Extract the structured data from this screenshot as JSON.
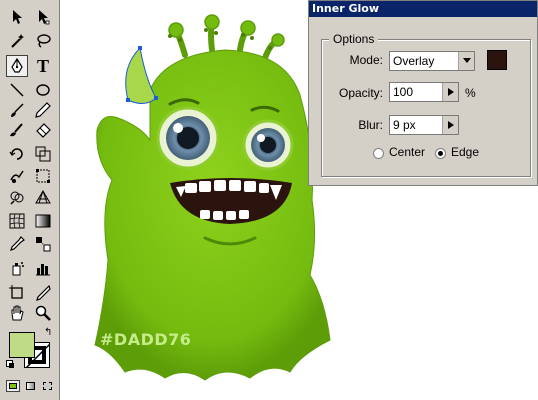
{
  "toolbox": {
    "tools": [
      {
        "name": "selection-tool",
        "icon": "arrow-icon"
      },
      {
        "name": "direct-selection-tool",
        "icon": "white-arrow-icon"
      },
      {
        "name": "magic-wand-tool",
        "icon": "wand-icon"
      },
      {
        "name": "lasso-tool",
        "icon": "lasso-icon"
      },
      {
        "name": "pen-tool",
        "icon": "pen-icon",
        "active": true
      },
      {
        "name": "type-tool",
        "icon": "type-icon",
        "glyph": "T"
      },
      {
        "name": "line-tool",
        "icon": "line-icon"
      },
      {
        "name": "ellipse-tool",
        "icon": "ellipse-icon"
      },
      {
        "name": "paintbrush-tool",
        "icon": "brush-icon"
      },
      {
        "name": "pencil-tool",
        "icon": "pencil-icon"
      },
      {
        "name": "blob-brush-tool",
        "icon": "blob-brush-icon"
      },
      {
        "name": "eraser-tool",
        "icon": "eraser-icon"
      },
      {
        "name": "rotate-tool",
        "icon": "rotate-icon"
      },
      {
        "name": "scale-tool",
        "icon": "scale-icon"
      },
      {
        "name": "warp-tool",
        "icon": "warp-icon"
      },
      {
        "name": "free-transform-tool",
        "icon": "free-transform-icon"
      },
      {
        "name": "shape-builder-tool",
        "icon": "shape-builder-icon"
      },
      {
        "name": "perspective-grid-tool",
        "icon": "perspective-icon"
      },
      {
        "name": "mesh-tool",
        "icon": "mesh-icon"
      },
      {
        "name": "gradient-tool",
        "icon": "gradient-icon"
      },
      {
        "name": "eyedropper-tool",
        "icon": "eyedropper-icon"
      },
      {
        "name": "blend-tool",
        "icon": "blend-icon"
      },
      {
        "name": "symbol-sprayer-tool",
        "icon": "symbol-sprayer-icon"
      },
      {
        "name": "column-graph-tool",
        "icon": "graph-icon"
      },
      {
        "name": "artboard-tool",
        "icon": "artboard-icon"
      },
      {
        "name": "slice-tool",
        "icon": "slice-icon"
      },
      {
        "name": "hand-tool",
        "icon": "hand-icon"
      },
      {
        "name": "zoom-tool",
        "icon": "zoom-icon"
      }
    ],
    "fill_color": "#bedb86",
    "stroke_color": "#ffffff",
    "screen_modes": [
      "normal-mode-icon",
      "behind-mode-icon",
      "inside-mode-icon"
    ]
  },
  "panel": {
    "title": "Inner Glow",
    "options_label": "Options",
    "mode_label": "Mode:",
    "mode_value": "Overlay",
    "glow_color": "#2b140e",
    "opacity_label": "Opacity:",
    "opacity_value": "100",
    "opacity_unit": "%",
    "blur_label": "Blur:",
    "blur_value": "9 px",
    "center_label": "Center",
    "edge_label": "Edge",
    "selected_radio": "Edge"
  },
  "canvas": {
    "watermark": "#DADD76",
    "monster_body_color": "#7dc214",
    "mouth_color": "#2b140e"
  }
}
